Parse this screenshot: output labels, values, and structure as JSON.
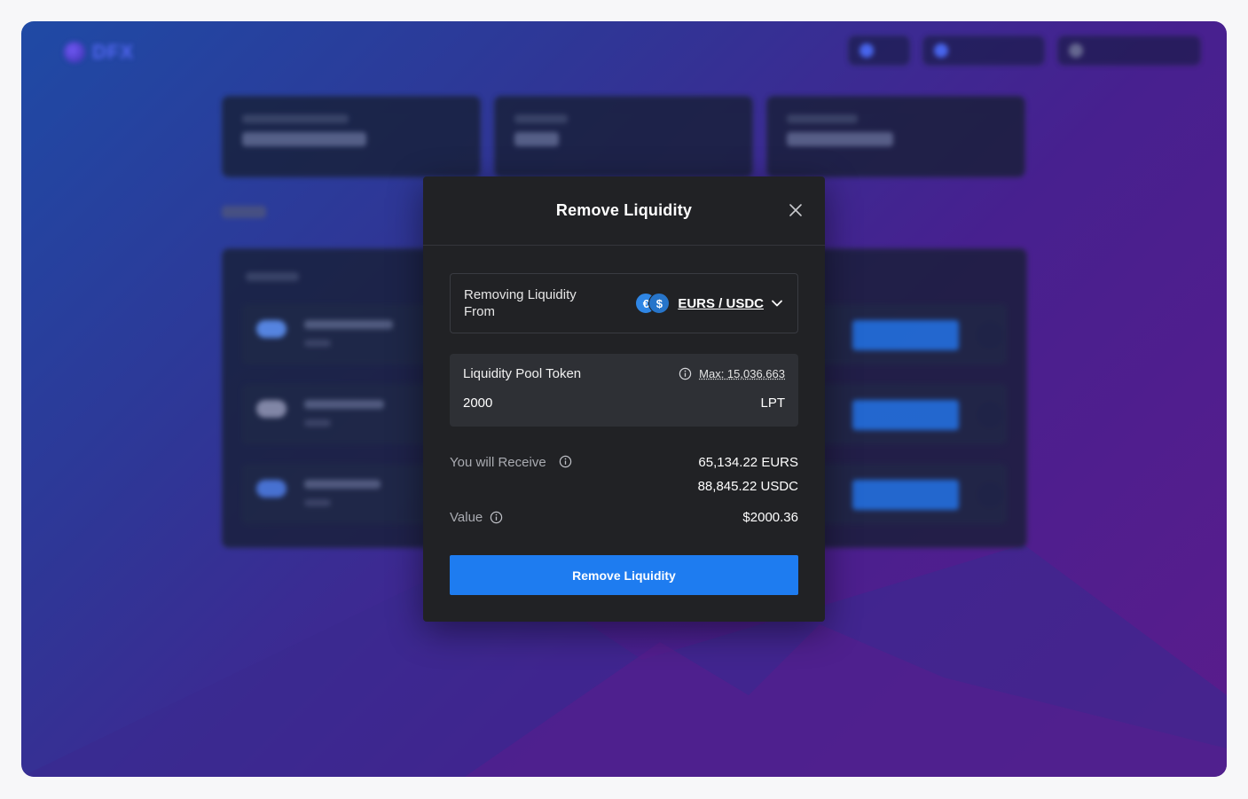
{
  "modal": {
    "title": "Remove Liquidity",
    "from_label": "Removing Liquidity From",
    "pair": "EURS / USDC",
    "pair_coin_1": "€",
    "pair_coin_2": "$",
    "lpt_label": "Liquidity Pool Token",
    "max_label": "Max: 15,036.663",
    "amount_value": "2000",
    "amount_unit": "LPT",
    "receive_label": "You will Receive",
    "receive_amounts": [
      "65,134.22 EURS",
      "88,845.22 USDC"
    ],
    "value_label": "Value",
    "value_amount": "$2000.36",
    "cta_label": "Remove Liquidity"
  },
  "colors": {
    "accent": "#1e7cf0",
    "modal_bg": "#212225",
    "box_bg": "#2e3035",
    "border": "#393b41"
  },
  "icons": [
    "close-icon",
    "chevron-down-icon",
    "info-icon",
    "eurs-coin-icon",
    "usdc-coin-icon"
  ]
}
